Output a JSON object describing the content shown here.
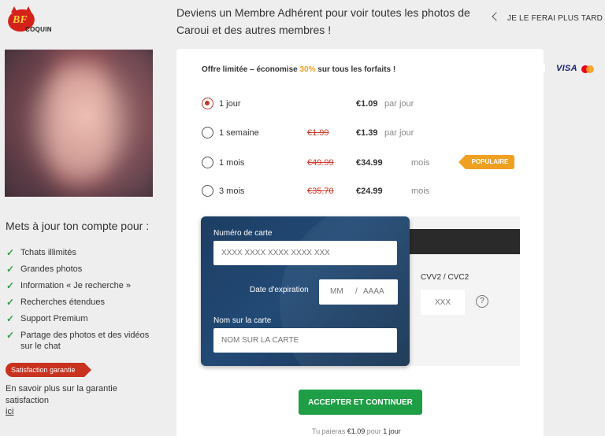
{
  "logo": {
    "mark": "BF",
    "name": "COQUIN"
  },
  "header": {
    "headline": "Deviens un Membre Adhérent pour voir toutes les photos de Caroui et des autres membres !",
    "later_label": "JE LE FERAI PLUS TARD"
  },
  "sidebar": {
    "upgrade_title": "Mets à jour ton compte pour :",
    "features": [
      "Tchats illimités",
      "Grandes photos",
      "Information « Je recherche »",
      "Recherches étendues",
      "Support Premium",
      "Partage des photos et des vidéos sur le chat"
    ],
    "satisfaction_badge": "Satisfaction garantie",
    "satisfaction_text": "En savoir plus sur la garantie satisfaction",
    "satisfaction_link": "ici"
  },
  "offer": {
    "prefix": "Offre limitée – économise ",
    "highlight": "30%",
    "suffix": " sur tous les forfaits !"
  },
  "plans": [
    {
      "label": "1 jour",
      "old_price": "",
      "price": "€1.09",
      "unit": "par jour",
      "selected": true
    },
    {
      "label": "1 semaine",
      "old_price": "€1.99",
      "price": "€1.39",
      "unit": "par jour",
      "selected": false
    },
    {
      "label": "1 mois",
      "old_price": "€49.99",
      "price": "€34.99",
      "unit": "mois",
      "selected": false
    },
    {
      "label": "3 mois",
      "old_price": "€35.70",
      "price": "€24.99",
      "unit": "mois",
      "selected": false
    }
  ],
  "popular_badge": "POPULAIRE",
  "payment": {
    "card_number_label": "Numéro de carte",
    "card_number_placeholder": "XXXX XXXX XXXX XXXX XXX",
    "expiry_label": "Date d'expiration",
    "expiry_month": "MM",
    "expiry_sep": "/",
    "expiry_year": "AAAA",
    "name_label": "Nom sur la carte",
    "name_placeholder": "NOM SUR LA CARTE",
    "cvv_label": "CVV2 / CVC2",
    "cvv_placeholder": "XXX",
    "help_glyph": "?"
  },
  "accept_button": "ACCEPTER ET CONTINUER",
  "pay_note": {
    "prefix": "Tu paieras ",
    "amount": "€1.09",
    "middle": " pour ",
    "duration": "1 jour"
  },
  "card_brands": {
    "visa": "VISA",
    "mastercard_icon": "mastercard-icon"
  },
  "colors": {
    "accent_green": "#1e9e45",
    "accent_orange": "#f0a020",
    "accent_red": "#c8321f",
    "card_blue": "#1d3d63"
  }
}
